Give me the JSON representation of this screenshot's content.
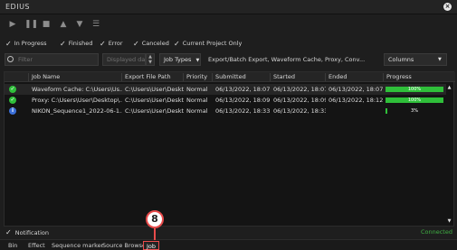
{
  "window": {
    "title": "EDIUS"
  },
  "toolbar": {
    "icons": [
      "play-icon",
      "pause-icon",
      "delete-icon",
      "move-up-icon",
      "move-down-icon",
      "list-icon"
    ]
  },
  "filters": {
    "in_progress": "In Progress",
    "finished": "Finished",
    "error": "Error",
    "canceled": "Canceled",
    "current_project_only": "Current Project Only"
  },
  "search": {
    "filter_placeholder": "Filter",
    "displayed_days_placeholder": "Displayed days",
    "job_types_label": "Job Types",
    "job_types_value": "Export/Batch Export, Waveform Cache, Proxy, Conv...",
    "columns_label": "Columns"
  },
  "table": {
    "headers": [
      "Job Name",
      "Export File Path",
      "Priority",
      "Submitted",
      "Started",
      "Ended",
      "Progress"
    ],
    "rows": [
      {
        "status": "finished",
        "name": "Waveform Cache: C:\\Users\\Us...",
        "path": "C:\\Users\\User\\Deskto...",
        "priority": "Normal",
        "submitted": "06/13/2022, 18:07...",
        "started": "06/13/2022, 18:07...",
        "ended": "06/13/2022, 18:07...",
        "progress": 1.0,
        "progress_label": "100%"
      },
      {
        "status": "finished",
        "name": "Proxy: C:\\Users\\User\\Desktop\\...",
        "path": "C:\\Users\\User\\Deskto...",
        "priority": "Normal",
        "submitted": "06/13/2022, 18:09...",
        "started": "06/13/2022, 18:09...",
        "ended": "06/13/2022, 18:12...",
        "progress": 1.0,
        "progress_label": "100%"
      },
      {
        "status": "info",
        "name": "NIKON_Sequence1_2022-06-1...",
        "path": "C:\\Users\\User\\Deskto...",
        "priority": "Normal",
        "submitted": "06/13/2022, 18:33...",
        "started": "06/13/2022, 18:33...",
        "ended": "",
        "progress": 0.03,
        "progress_label": "3%"
      }
    ]
  },
  "footer": {
    "notification": "Notification",
    "status": "Connected"
  },
  "tabs": [
    "Bin",
    "Effect",
    "Sequence marker",
    "Source Browser",
    "Job"
  ],
  "callout": {
    "number": "8"
  },
  "colors": {
    "accent_green": "#2fbf3a",
    "info_blue": "#3b6fd8",
    "callout_red": "#e84b4b"
  }
}
